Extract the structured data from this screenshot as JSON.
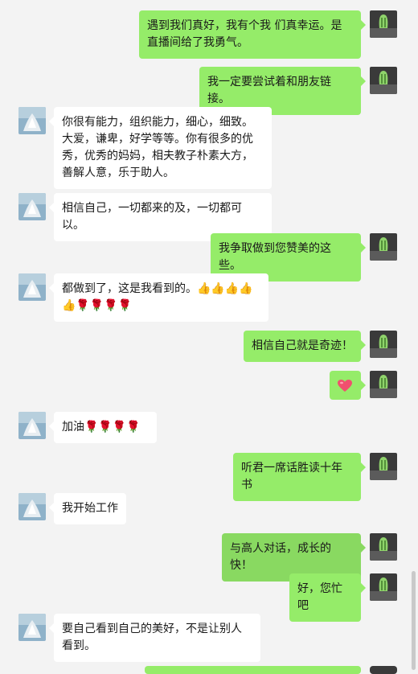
{
  "messages": [
    {
      "side": "right",
      "text": "遇到我们真好，我有个我 们真幸运。是直播间给了我勇气。"
    },
    {
      "side": "right",
      "text": "我一定要尝试着和朋友链接。"
    },
    {
      "side": "left",
      "text": "你很有能力，组织能力，细心，细致。大爱，谦卑，好学等等。你有很多的优秀，优秀的妈妈，相夫教子朴素大方，善解人意，乐于助人。"
    },
    {
      "side": "left",
      "text": "相信自己，一切都来的及，一切都可以。"
    },
    {
      "side": "right",
      "text": "我争取做到您赞美的这些。"
    },
    {
      "side": "left",
      "text": "都做到了，这是我看到的。👍👍👍👍👍🌹🌹🌹🌹"
    },
    {
      "side": "right",
      "text": "相信自己就是奇迹！"
    },
    {
      "side": "right",
      "text": "",
      "icon": "heart-emoji"
    },
    {
      "side": "left",
      "text": "加油🌹🌹🌹🌹"
    },
    {
      "side": "right",
      "text": "听君一席话胜读十年书"
    },
    {
      "side": "left",
      "text": "我开始工作"
    },
    {
      "side": "right",
      "text": "与高人对话，成长的快！",
      "highlight": true
    },
    {
      "side": "right",
      "text": "好，您忙吧"
    },
    {
      "side": "left",
      "text": "要自己看到自己的美好，不是让别人看到。"
    }
  ],
  "colors": {
    "sent_bubble": "#95ec69",
    "received_bubble": "#ffffff",
    "background": "#f3f3f3"
  }
}
